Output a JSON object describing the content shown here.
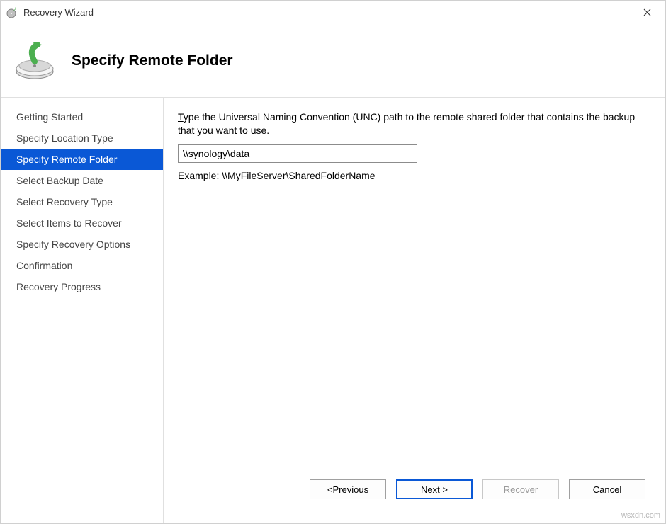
{
  "window": {
    "title": "Recovery Wizard"
  },
  "header": {
    "title": "Specify Remote Folder"
  },
  "sidebar": {
    "steps": [
      "Getting Started",
      "Specify Location Type",
      "Specify Remote Folder",
      "Select Backup Date",
      "Select Recovery Type",
      "Select Items to Recover",
      "Specify Recovery Options",
      "Confirmation",
      "Recovery Progress"
    ],
    "activeIndex": 2
  },
  "main": {
    "prompt_pre": "T",
    "prompt_rest": "ype the Universal Naming Convention (UNC) path to the remote shared folder that contains the backup that you want to use.",
    "path_value": "\\\\synology\\data",
    "example": "Example: \\\\MyFileServer\\SharedFolderName"
  },
  "buttons": {
    "previous_pre": "< ",
    "previous_u": "P",
    "previous_post": "revious",
    "next_u": "N",
    "next_post": "ext >",
    "recover_u": "R",
    "recover_post": "ecover",
    "cancel": "Cancel"
  },
  "watermark": "wsxdn.com"
}
